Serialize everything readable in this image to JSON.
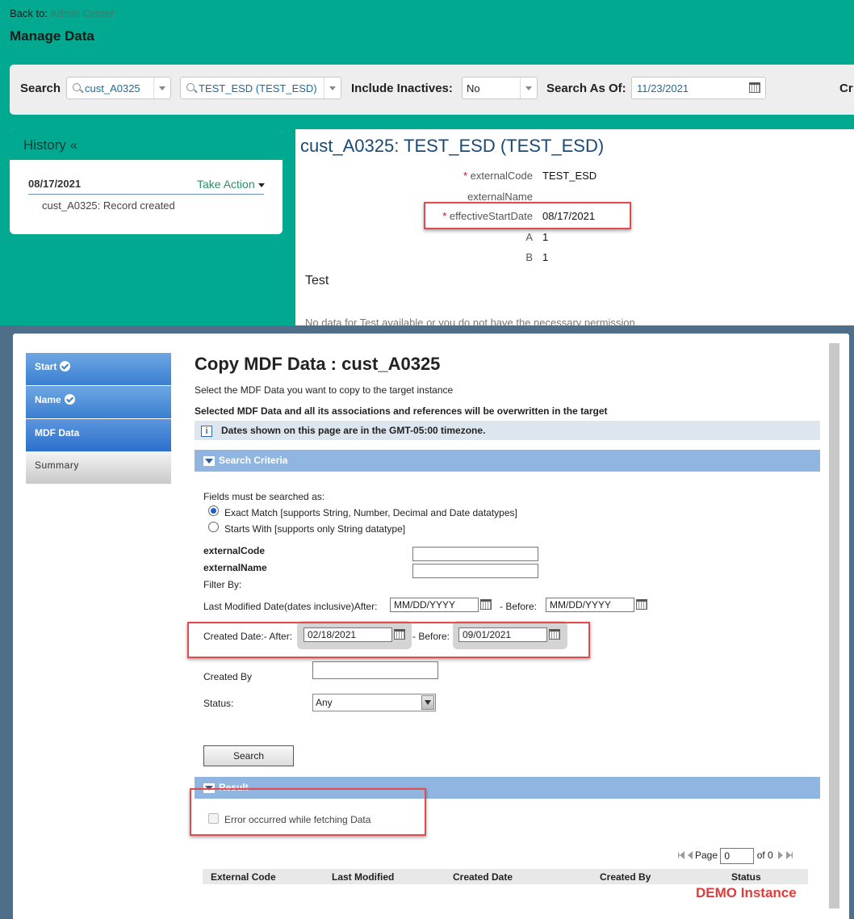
{
  "manage": {
    "back_prefix": "Back to:",
    "back_link": "Admin Center",
    "title": "Manage Data",
    "search_label": "Search",
    "object_value": "cust_A0325",
    "record_value": "TEST_ESD (TEST_ESD)",
    "include_inactives_label": "Include Inactives:",
    "include_inactives_value": "No",
    "search_as_of_label": "Search As Of:",
    "search_as_of_value": "11/23/2021",
    "cut_label": "Cr"
  },
  "history": {
    "title": "History «",
    "date": "08/17/2021",
    "take_action": "Take Action",
    "entry": "cust_A0325: Record created"
  },
  "record": {
    "title": "cust_A0325: TEST_ESD (TEST_ESD)",
    "fields": [
      {
        "label": "externalCode",
        "required": "*",
        "value": "TEST_ESD"
      },
      {
        "label": "externalName",
        "required": "",
        "value": ""
      },
      {
        "label": "effectiveStartDate",
        "required": "*",
        "value": "08/17/2021"
      },
      {
        "label": "A",
        "required": "",
        "value": "1"
      },
      {
        "label": "B",
        "required": "",
        "value": "1"
      }
    ],
    "section_title": "Test",
    "no_data": "No data for Test available or you do not have the necessary permission"
  },
  "wizard": {
    "steps": [
      "Start",
      "Name",
      "MDF Data",
      "Summary"
    ]
  },
  "copy": {
    "title": "Copy MDF Data : cust_A0325",
    "subtitle": "Select the MDF Data you want to copy to the target instance",
    "warning": "Selected MDF Data and all its associations and references will be overwritten in the target",
    "timezone_note": "Dates shown on this page are in the GMT-05:00 timezone.",
    "search_criteria_label": "Search Criteria",
    "fields_searched_as": "Fields must be searched as:",
    "exact_match": "Exact Match [supports String, Number, Decimal and Date datatypes]",
    "starts_with": "Starts With [supports only String datatype]",
    "external_code_label": "externalCode",
    "external_name_label": "externalName",
    "filter_by": "Filter By:",
    "last_modified_label": "Last Modified Date(dates inclusive)After:",
    "last_modified_after": "MM/DD/YYYY",
    "before_label": "- Before:",
    "last_modified_before": "MM/DD/YYYY",
    "created_date_label": "Created Date:- After:",
    "created_after": "02/18/2021",
    "created_before_label": "- Before:",
    "created_before": "09/01/2021",
    "created_by_label": "Created By",
    "status_label": "Status:",
    "status_value": "Any",
    "search_button": "Search",
    "result_label": "Result",
    "error_message": "Error occurred while fetching Data",
    "page_label": "Page",
    "page_value": "0",
    "of_label": "of 0",
    "columns": [
      "External Code",
      "Last Modified",
      "Created Date",
      "Created By",
      "Status"
    ]
  },
  "watermark": "DEMO Instance",
  "colors": {
    "teal": "#00a98f",
    "highlight_red": "#e5484d",
    "section_blue": "#8fb5e0",
    "wizard_blue": "#3a7fd0"
  }
}
